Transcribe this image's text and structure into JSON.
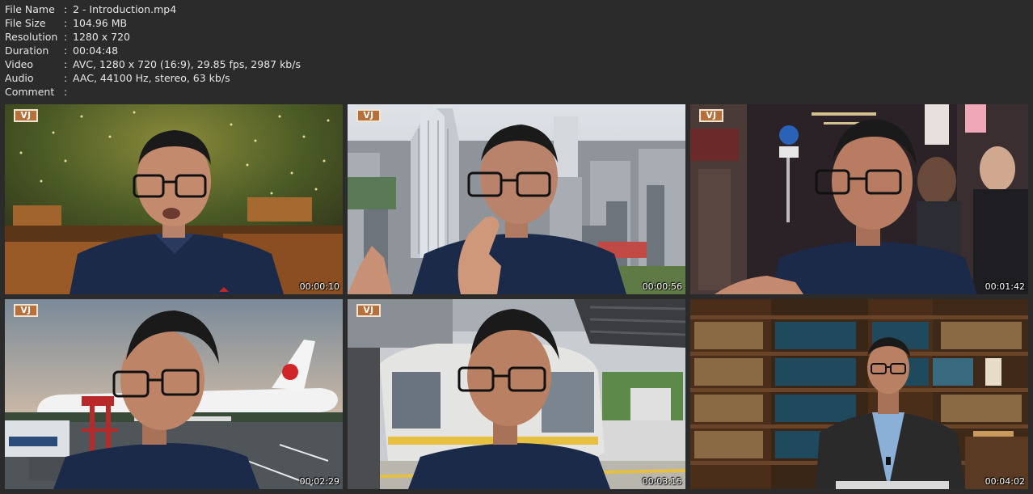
{
  "info": [
    {
      "key": "File Name",
      "sep": ":",
      "value": "2 - Introduction.mp4"
    },
    {
      "key": "File Size",
      "sep": ":",
      "value": "104.96 MB"
    },
    {
      "key": "Resolution",
      "sep": ":",
      "value": "1280 x 720"
    },
    {
      "key": "Duration",
      "sep": ":",
      "value": "00:04:48"
    },
    {
      "key": "Video",
      "sep": ":",
      "value": "AVC, 1280 x 720 (16:9), 29.85 fps, 2987 kb/s"
    },
    {
      "key": "Audio",
      "sep": ":",
      "value": "AAC, 44100 Hz, stereo, 63 kb/s"
    },
    {
      "key": "Comment",
      "sep": ":",
      "value": ""
    }
  ],
  "thumbnails": [
    {
      "timestamp": "00:00:10",
      "badge": "VJ",
      "scene": "restaurant-terrace"
    },
    {
      "timestamp": "00:00:56",
      "badge": "VJ",
      "scene": "city-skyline"
    },
    {
      "timestamp": "00:01:42",
      "badge": "VJ",
      "scene": "night-alley"
    },
    {
      "timestamp": "00:02:29",
      "badge": "VJ",
      "scene": "airport-tarmac",
      "airline_logo": "JAL"
    },
    {
      "timestamp": "00:03:15",
      "badge": "VJ",
      "scene": "tram-station"
    },
    {
      "timestamp": "00:04:02",
      "badge": "",
      "scene": "bookshelf-studio"
    }
  ],
  "colors": {
    "background": "#2b2b2b",
    "text": "#e6e6e6",
    "badge": "#b8703a",
    "shirt": "#1c2a4a"
  }
}
